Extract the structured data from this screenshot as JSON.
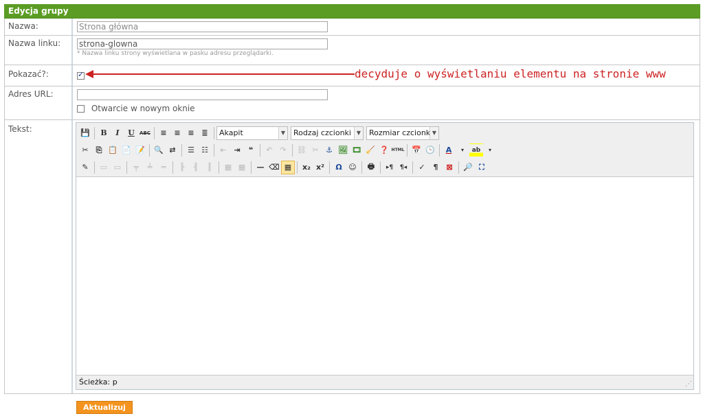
{
  "header": {
    "title": "Edycja grupy"
  },
  "fields": {
    "name": {
      "label": "Nazwa:",
      "value": "Strona główna"
    },
    "link": {
      "label": "Nazwa linku:",
      "value": "strona-glowna",
      "hint": "* Nazwa linku strony wyświetlana w pasku adresu przeglądarki."
    },
    "show": {
      "label": "Pokazać?:",
      "checked": true,
      "annotation": "decyduje o wyświetlaniu elementu na stronie www"
    },
    "url": {
      "label": "Adres URL:",
      "value": "",
      "newwindow_label": "Otwarcie w nowym oknie"
    },
    "text": {
      "label": "Tekst:"
    }
  },
  "editor": {
    "row1": {
      "bold": "B",
      "italic": "I",
      "underline": "U",
      "strike": "ABC"
    },
    "format_select": "Akapit",
    "font_select": "Rodzaj czcionki",
    "size_select": "Rozmiar czcionki",
    "status_path": "Ścieżka: p"
  },
  "submit_label": "Aktualizuj"
}
